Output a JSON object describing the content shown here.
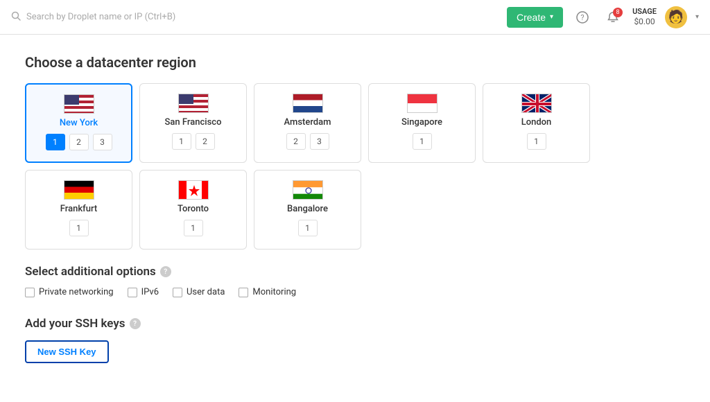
{
  "header": {
    "search_placeholder": "Search by Droplet name or IP (Ctrl+B)",
    "create_label": "Create",
    "notif_count": "8",
    "usage_label": "USAGE",
    "usage_amount": "$0.00"
  },
  "section": {
    "datacenter_title": "Choose a datacenter region",
    "additional_options_title": "Select additional options",
    "ssh_keys_title": "Add your SSH keys"
  },
  "regions": [
    {
      "id": "new-york",
      "name": "New York",
      "flag": "us",
      "numbers": [
        "1",
        "2",
        "3"
      ],
      "active_num": "1",
      "selected": true
    },
    {
      "id": "san-francisco",
      "name": "San Francisco",
      "flag": "us",
      "numbers": [
        "1",
        "2"
      ],
      "active_num": null,
      "selected": false
    },
    {
      "id": "amsterdam",
      "name": "Amsterdam",
      "flag": "nl",
      "numbers": [
        "2",
        "3"
      ],
      "active_num": null,
      "selected": false
    },
    {
      "id": "singapore",
      "name": "Singapore",
      "flag": "sg",
      "numbers": [
        "1"
      ],
      "active_num": null,
      "selected": false
    },
    {
      "id": "london",
      "name": "London",
      "flag": "gb",
      "numbers": [
        "1"
      ],
      "active_num": null,
      "selected": false
    },
    {
      "id": "frankfurt",
      "name": "Frankfurt",
      "flag": "de",
      "numbers": [
        "1"
      ],
      "active_num": null,
      "selected": false
    },
    {
      "id": "toronto",
      "name": "Toronto",
      "flag": "ca",
      "numbers": [
        "1"
      ],
      "active_num": null,
      "selected": false
    },
    {
      "id": "bangalore",
      "name": "Bangalore",
      "flag": "in",
      "numbers": [
        "1"
      ],
      "active_num": null,
      "selected": false
    }
  ],
  "additional_options": [
    {
      "id": "private-networking",
      "label": "Private networking"
    },
    {
      "id": "ipv6",
      "label": "IPv6"
    },
    {
      "id": "user-data",
      "label": "User data"
    },
    {
      "id": "monitoring",
      "label": "Monitoring"
    }
  ],
  "ssh": {
    "new_key_label": "New SSH Key"
  }
}
